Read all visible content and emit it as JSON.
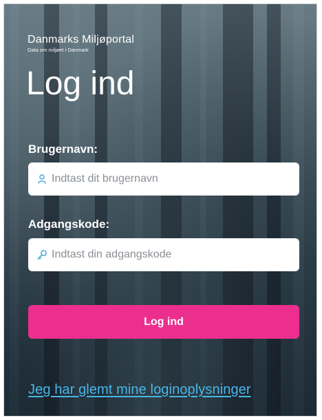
{
  "brand": {
    "name": "Danmarks Miljøportal",
    "tagline": "Data om miljøet i Danmark"
  },
  "page": {
    "title": "Log ind"
  },
  "username": {
    "label": "Brugernavn:",
    "placeholder": "Indtast dit brugernavn",
    "value": "",
    "icon": "user-icon"
  },
  "password": {
    "label": "Adgangskode:",
    "placeholder": "Indtast din adgangskode",
    "value": "",
    "icon": "key-icon"
  },
  "actions": {
    "login_label": "Log ind",
    "forgot_label": "Jeg har glemt mine loginoplysninger"
  },
  "colors": {
    "accent": "#ec2f8f",
    "link": "#49b6e8",
    "icon": "#4aa8d8"
  }
}
